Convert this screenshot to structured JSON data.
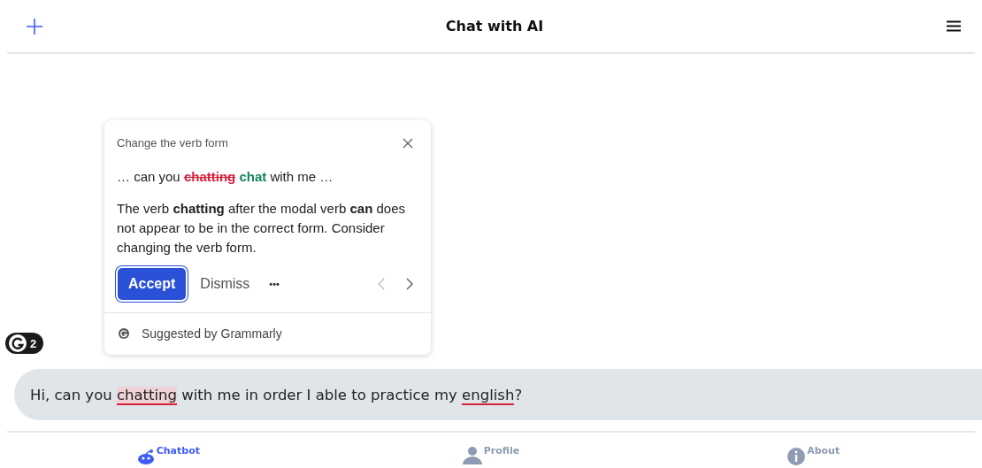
{
  "header": {
    "title": "Chat with AI"
  },
  "grammarly_badge": {
    "count": "2"
  },
  "suggestion_card": {
    "heading": "Change the verb form",
    "excerpt": {
      "before": "… can you",
      "removed": "chatting",
      "inserted": "chat",
      "after": "with me …"
    },
    "explanation": "The verb **chatting** after the modal verb **can** does not appear to be in the correct form. Consider changing the verb form.",
    "accept": "Accept",
    "dismiss": "Dismiss",
    "more": "•••",
    "footer": "Suggested by Grammarly"
  },
  "message": {
    "segments": [
      {
        "text": "Hi, can you ",
        "kind": "plain"
      },
      {
        "text": "chatting",
        "kind": "grammar"
      },
      {
        "text": " with me in order I able to practice my ",
        "kind": "plain"
      },
      {
        "text": "english",
        "kind": "spelling"
      },
      {
        "text": "?",
        "kind": "plain"
      }
    ]
  },
  "nav": [
    {
      "label": "Chatbot",
      "kind": "bot",
      "selected": true
    },
    {
      "label": "Profile",
      "kind": "person",
      "selected": false
    },
    {
      "label": "About",
      "kind": "info",
      "selected": false
    }
  ]
}
